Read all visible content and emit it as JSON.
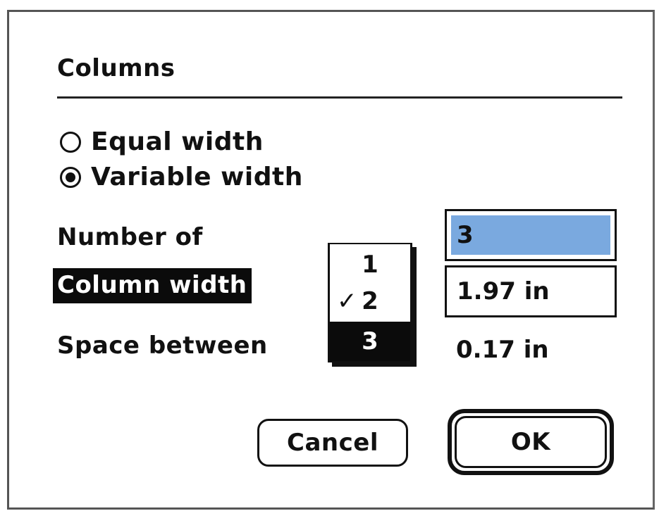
{
  "dialog": {
    "title": "Columns",
    "radios": [
      {
        "label": "Equal width",
        "selected": false
      },
      {
        "label": "Variable width",
        "selected": true
      }
    ],
    "labels": {
      "number_of": "Number of",
      "column_width": "Column width",
      "space_between": "Space between"
    },
    "popup_menu": {
      "items": [
        "1",
        "2",
        "3"
      ],
      "checked_item": "2",
      "highlighted_item": "3",
      "check_mark": "✓"
    },
    "fields": {
      "number_of_value": "3",
      "column_width_value": "1.97 in",
      "space_between_value": "0.17 in"
    },
    "buttons": {
      "cancel": "Cancel",
      "ok": "OK"
    }
  },
  "colors": {
    "selection_highlight": "#7aa9df",
    "inverted_background": "#0b0b0b"
  }
}
